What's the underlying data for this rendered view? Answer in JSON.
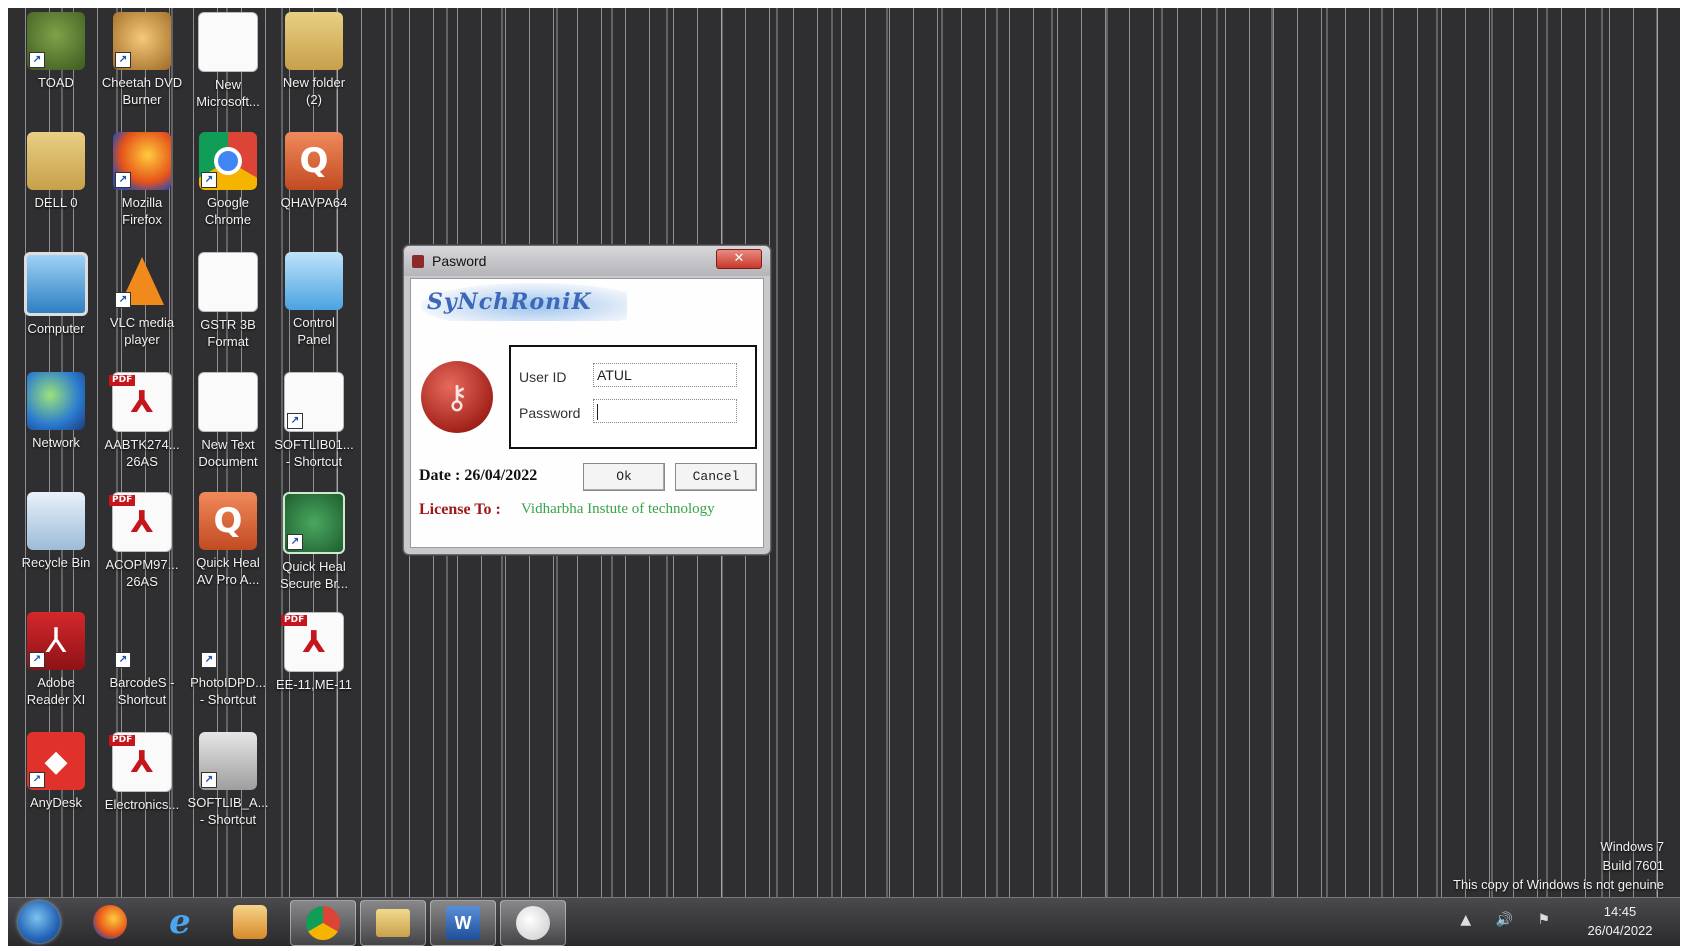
{
  "desktop_icons": [
    {
      "label": "TOAD",
      "icon": "frog-icon"
    },
    {
      "label": "Cheetah DVD\nBurner",
      "icon": "cheetah-icon"
    },
    {
      "label": "New\nMicrosoft...",
      "icon": "document-icon"
    },
    {
      "label": "New folder\n(2)",
      "icon": "folder-icon"
    },
    {
      "label": "DELL 0",
      "icon": "folder-icon"
    },
    {
      "label": "Mozilla\nFirefox",
      "icon": "firefox-icon"
    },
    {
      "label": "Google\nChrome",
      "icon": "chrome-icon"
    },
    {
      "label": "QHAVPA64",
      "icon": "quickheal-icon"
    },
    {
      "label": "Computer",
      "icon": "computer-icon"
    },
    {
      "label": "VLC media\nplayer",
      "icon": "vlc-icon"
    },
    {
      "label": "GSTR 3B\nFormat",
      "icon": "document-icon"
    },
    {
      "label": "Control\nPanel",
      "icon": "control-panel-icon"
    },
    {
      "label": "Network",
      "icon": "network-icon"
    },
    {
      "label": "AABTK274...\n26AS",
      "icon": "pdf-icon"
    },
    {
      "label": "New Text\nDocument",
      "icon": "text-document-icon"
    },
    {
      "label": "SOFTLIB01...\n- Shortcut",
      "icon": "document-icon"
    },
    {
      "label": "Recycle Bin",
      "icon": "recycle-bin-icon"
    },
    {
      "label": "ACOPM97...\n26AS",
      "icon": "pdf-icon"
    },
    {
      "label": "Quick Heal\nAV Pro A...",
      "icon": "quickheal-icon"
    },
    {
      "label": "Quick Heal\nSecure Br...",
      "icon": "globe-icon"
    },
    {
      "label": "Adobe\nReader XI",
      "icon": "adobe-reader-icon"
    },
    {
      "label": "BarcodeS -\nShortcut",
      "icon": "shortcut-icon"
    },
    {
      "label": "PhotoIDPD...\n- Shortcut",
      "icon": "shield-icon"
    },
    {
      "label": "EE-11,ME-11",
      "icon": "pdf-icon"
    },
    {
      "label": "AnyDesk",
      "icon": "anydesk-icon"
    },
    {
      "label": "Electronics...",
      "icon": "pdf-icon"
    },
    {
      "label": "SOFTLIB_A...\n- Shortcut",
      "icon": "softlib-icon"
    }
  ],
  "dialog": {
    "title": "Pasword",
    "close_glyph": "✕",
    "brand": "SyNchRoniK",
    "user_id_label": "User ID",
    "user_id_value": "ATUL",
    "password_label": "Password",
    "date_text": "Date : 26/04/2022",
    "ok_label": "Ok",
    "cancel_label": "Cancel",
    "license_label": "License To :",
    "license_value": "Vidharbha Instute of technology"
  },
  "watermark": {
    "line1": "Windows 7",
    "line2": "Build 7601",
    "line3": "This copy of Windows is not genuine"
  },
  "taskbar": {
    "items": [
      "firefox-icon",
      "ie-icon",
      "media-player-icon",
      "chrome-icon",
      "folder-icon",
      "word-icon",
      "paint-icon"
    ],
    "ie_glyph": "e",
    "word_glyph": "W",
    "tray_glyphs": "▲ 🔊 ⚑",
    "time": "14:45",
    "date": "26/04/2022"
  },
  "colors": {
    "desktop_bg": "#2f2f31",
    "license_label": "#a01818",
    "license_value": "#38a34a",
    "brand": "#3b68b8"
  }
}
